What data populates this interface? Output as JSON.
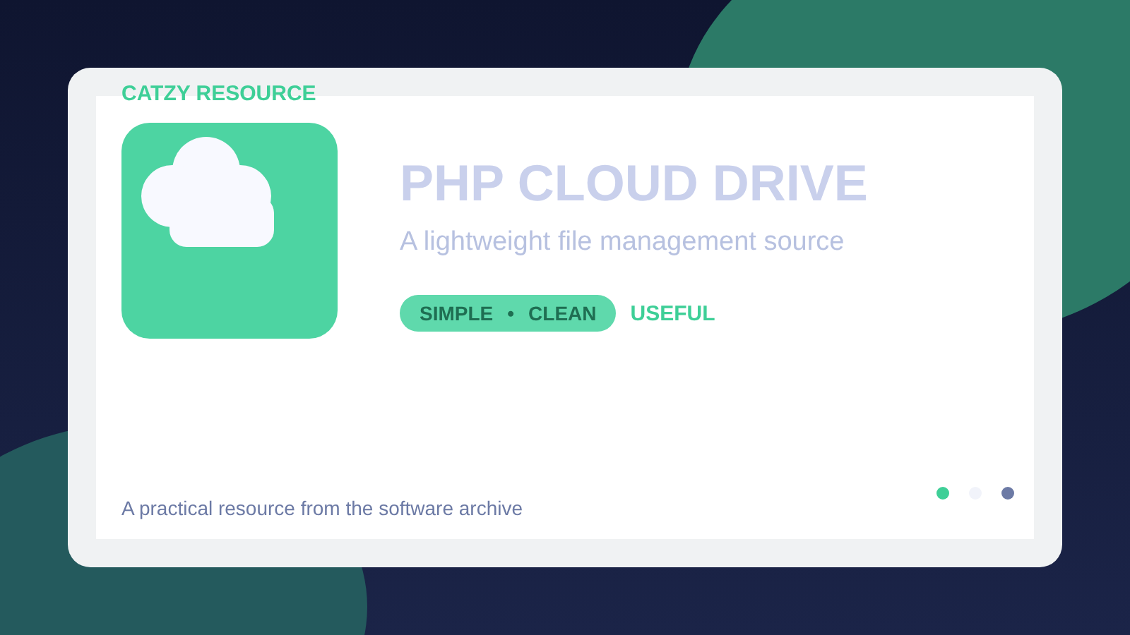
{
  "brand": "CATZY RESOURCE",
  "title": "PHP CLOUD DRIVE",
  "subtitle": "A lightweight file management source",
  "tags": [
    {
      "label": "SIMPLE",
      "kind": "pill"
    },
    {
      "label": "•",
      "kind": "pill"
    },
    {
      "label": "CLEAN",
      "kind": "pill"
    },
    {
      "label": "USEFUL",
      "kind": "plain"
    }
  ],
  "footer": "A practical resource from the software archive",
  "dots": [
    {
      "color": "#3ecf97"
    },
    {
      "color": "#f1f3fa"
    },
    {
      "color": "#6c7aa5"
    }
  ]
}
